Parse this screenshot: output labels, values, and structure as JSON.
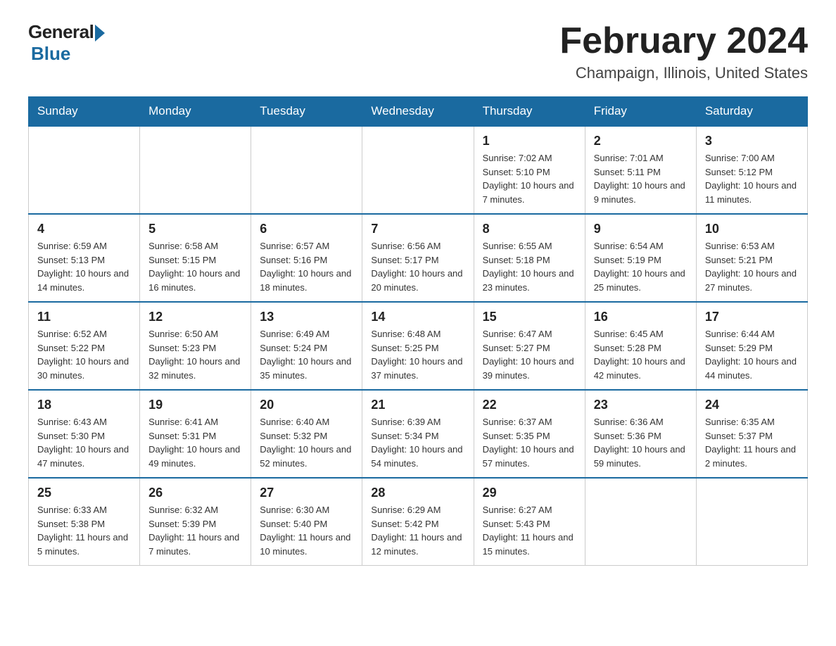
{
  "header": {
    "logo": {
      "general": "General",
      "blue": "Blue"
    },
    "title": "February 2024",
    "location": "Champaign, Illinois, United States"
  },
  "days_of_week": [
    "Sunday",
    "Monday",
    "Tuesday",
    "Wednesday",
    "Thursday",
    "Friday",
    "Saturday"
  ],
  "weeks": [
    [
      {
        "day": "",
        "info": ""
      },
      {
        "day": "",
        "info": ""
      },
      {
        "day": "",
        "info": ""
      },
      {
        "day": "",
        "info": ""
      },
      {
        "day": "1",
        "info": "Sunrise: 7:02 AM\nSunset: 5:10 PM\nDaylight: 10 hours and 7 minutes."
      },
      {
        "day": "2",
        "info": "Sunrise: 7:01 AM\nSunset: 5:11 PM\nDaylight: 10 hours and 9 minutes."
      },
      {
        "day": "3",
        "info": "Sunrise: 7:00 AM\nSunset: 5:12 PM\nDaylight: 10 hours and 11 minutes."
      }
    ],
    [
      {
        "day": "4",
        "info": "Sunrise: 6:59 AM\nSunset: 5:13 PM\nDaylight: 10 hours and 14 minutes."
      },
      {
        "day": "5",
        "info": "Sunrise: 6:58 AM\nSunset: 5:15 PM\nDaylight: 10 hours and 16 minutes."
      },
      {
        "day": "6",
        "info": "Sunrise: 6:57 AM\nSunset: 5:16 PM\nDaylight: 10 hours and 18 minutes."
      },
      {
        "day": "7",
        "info": "Sunrise: 6:56 AM\nSunset: 5:17 PM\nDaylight: 10 hours and 20 minutes."
      },
      {
        "day": "8",
        "info": "Sunrise: 6:55 AM\nSunset: 5:18 PM\nDaylight: 10 hours and 23 minutes."
      },
      {
        "day": "9",
        "info": "Sunrise: 6:54 AM\nSunset: 5:19 PM\nDaylight: 10 hours and 25 minutes."
      },
      {
        "day": "10",
        "info": "Sunrise: 6:53 AM\nSunset: 5:21 PM\nDaylight: 10 hours and 27 minutes."
      }
    ],
    [
      {
        "day": "11",
        "info": "Sunrise: 6:52 AM\nSunset: 5:22 PM\nDaylight: 10 hours and 30 minutes."
      },
      {
        "day": "12",
        "info": "Sunrise: 6:50 AM\nSunset: 5:23 PM\nDaylight: 10 hours and 32 minutes."
      },
      {
        "day": "13",
        "info": "Sunrise: 6:49 AM\nSunset: 5:24 PM\nDaylight: 10 hours and 35 minutes."
      },
      {
        "day": "14",
        "info": "Sunrise: 6:48 AM\nSunset: 5:25 PM\nDaylight: 10 hours and 37 minutes."
      },
      {
        "day": "15",
        "info": "Sunrise: 6:47 AM\nSunset: 5:27 PM\nDaylight: 10 hours and 39 minutes."
      },
      {
        "day": "16",
        "info": "Sunrise: 6:45 AM\nSunset: 5:28 PM\nDaylight: 10 hours and 42 minutes."
      },
      {
        "day": "17",
        "info": "Sunrise: 6:44 AM\nSunset: 5:29 PM\nDaylight: 10 hours and 44 minutes."
      }
    ],
    [
      {
        "day": "18",
        "info": "Sunrise: 6:43 AM\nSunset: 5:30 PM\nDaylight: 10 hours and 47 minutes."
      },
      {
        "day": "19",
        "info": "Sunrise: 6:41 AM\nSunset: 5:31 PM\nDaylight: 10 hours and 49 minutes."
      },
      {
        "day": "20",
        "info": "Sunrise: 6:40 AM\nSunset: 5:32 PM\nDaylight: 10 hours and 52 minutes."
      },
      {
        "day": "21",
        "info": "Sunrise: 6:39 AM\nSunset: 5:34 PM\nDaylight: 10 hours and 54 minutes."
      },
      {
        "day": "22",
        "info": "Sunrise: 6:37 AM\nSunset: 5:35 PM\nDaylight: 10 hours and 57 minutes."
      },
      {
        "day": "23",
        "info": "Sunrise: 6:36 AM\nSunset: 5:36 PM\nDaylight: 10 hours and 59 minutes."
      },
      {
        "day": "24",
        "info": "Sunrise: 6:35 AM\nSunset: 5:37 PM\nDaylight: 11 hours and 2 minutes."
      }
    ],
    [
      {
        "day": "25",
        "info": "Sunrise: 6:33 AM\nSunset: 5:38 PM\nDaylight: 11 hours and 5 minutes."
      },
      {
        "day": "26",
        "info": "Sunrise: 6:32 AM\nSunset: 5:39 PM\nDaylight: 11 hours and 7 minutes."
      },
      {
        "day": "27",
        "info": "Sunrise: 6:30 AM\nSunset: 5:40 PM\nDaylight: 11 hours and 10 minutes."
      },
      {
        "day": "28",
        "info": "Sunrise: 6:29 AM\nSunset: 5:42 PM\nDaylight: 11 hours and 12 minutes."
      },
      {
        "day": "29",
        "info": "Sunrise: 6:27 AM\nSunset: 5:43 PM\nDaylight: 11 hours and 15 minutes."
      },
      {
        "day": "",
        "info": ""
      },
      {
        "day": "",
        "info": ""
      }
    ]
  ]
}
